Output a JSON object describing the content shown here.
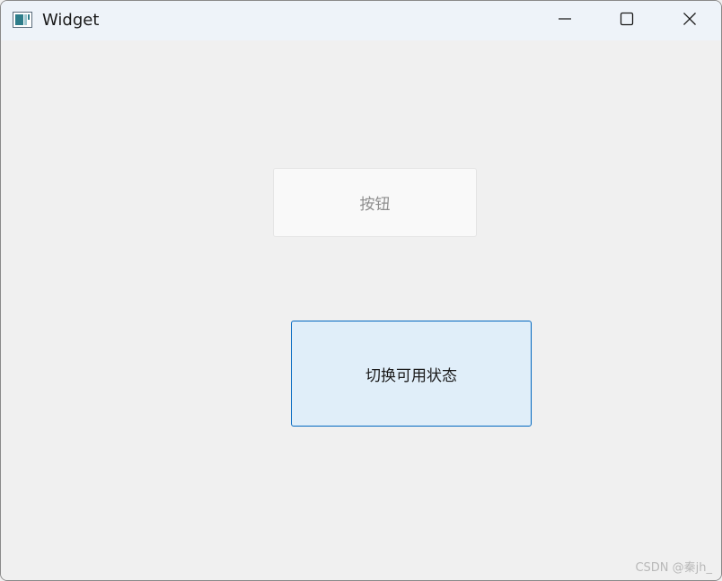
{
  "window": {
    "title": "Widget"
  },
  "buttons": {
    "disabled_label": "按钮",
    "toggle_label": "切换可用状态"
  },
  "watermark": "CSDN @秦jh_",
  "colors": {
    "titlebar": "#eef3f9",
    "client_bg": "#f0f0f0",
    "accent_border": "#0067c0",
    "toggle_bg": "#e0eef9",
    "disabled_text": "#8e8e8e"
  },
  "icons": {
    "app": "qt-widget-icon",
    "minimize": "minimize-icon",
    "maximize": "maximize-icon",
    "close": "close-icon"
  }
}
